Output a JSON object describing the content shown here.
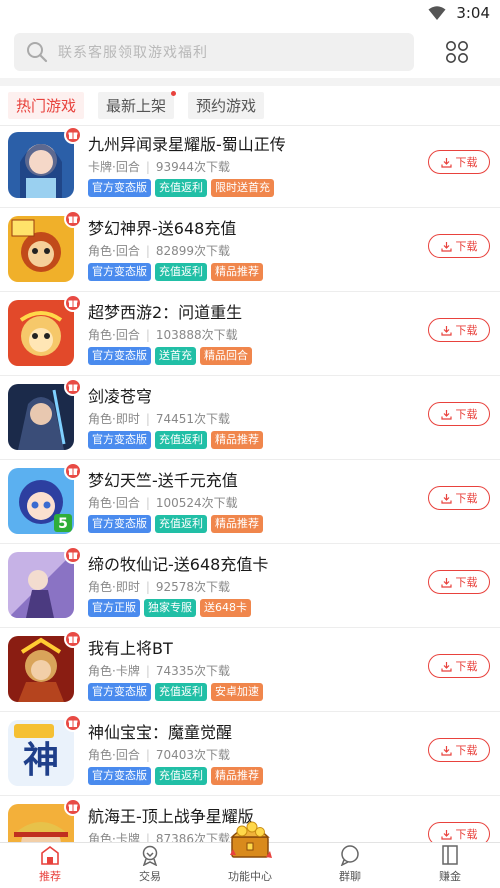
{
  "status_bar": {
    "time": "3:04"
  },
  "search": {
    "placeholder": "联系客服领取游戏福利"
  },
  "tabs": [
    {
      "label": "热门游戏",
      "active": true
    },
    {
      "label": "最新上架",
      "active": false,
      "dot": true
    },
    {
      "label": "预约游戏",
      "active": false
    }
  ],
  "games": [
    {
      "name": "九州异闻录星耀版-蜀山正传",
      "category": "卡牌·回合",
      "downloads": "93944次下载",
      "tags": [
        {
          "text": "官方变态版",
          "color": "blue"
        },
        {
          "text": "充值返利",
          "color": "teal"
        },
        {
          "text": "限时送首充",
          "color": "orange"
        }
      ],
      "download_label": "下载",
      "icon": "anime-girl-icon"
    },
    {
      "name": "梦幻神界-送648充值",
      "category": "角色·回合",
      "downloads": "82899次下载",
      "tags": [
        {
          "text": "官方变态版",
          "color": "blue"
        },
        {
          "text": "充值返利",
          "color": "teal"
        },
        {
          "text": "精品推荐",
          "color": "orange"
        }
      ],
      "download_label": "下载",
      "icon": "monkey-king-icon"
    },
    {
      "name": "超梦西游2：问道重生",
      "category": "角色·回合",
      "downloads": "103888次下载",
      "tags": [
        {
          "text": "官方变态版",
          "color": "blue"
        },
        {
          "text": "送首充",
          "color": "teal"
        },
        {
          "text": "精品回合",
          "color": "orange"
        }
      ],
      "download_label": "下载",
      "icon": "golden-monkey-icon"
    },
    {
      "name": "剑凌苍穹",
      "category": "角色·即时",
      "downloads": "74451次下载",
      "tags": [
        {
          "text": "官方变态版",
          "color": "blue"
        },
        {
          "text": "充值返利",
          "color": "teal"
        },
        {
          "text": "精品推荐",
          "color": "orange"
        }
      ],
      "download_label": "下载",
      "icon": "swordsman-icon"
    },
    {
      "name": "梦幻天竺-送千元充值",
      "category": "角色·回合",
      "downloads": "100524次下载",
      "tags": [
        {
          "text": "官方变态版",
          "color": "blue"
        },
        {
          "text": "充值返利",
          "color": "teal"
        },
        {
          "text": "精品推荐",
          "color": "orange"
        }
      ],
      "download_label": "下载",
      "icon": "blue-hair-girl-icon",
      "badge": "5"
    },
    {
      "name": "缔の牧仙记-送648充值卡",
      "category": "角色·即时",
      "downloads": "92578次下载",
      "tags": [
        {
          "text": "官方正版",
          "color": "blue"
        },
        {
          "text": "独家专服",
          "color": "teal"
        },
        {
          "text": "送648卡",
          "color": "orange"
        }
      ],
      "download_label": "下载",
      "icon": "fairy-warrior-icon"
    },
    {
      "name": "我有上将BT",
      "category": "角色·卡牌",
      "downloads": "74335次下载",
      "tags": [
        {
          "text": "官方变态版",
          "color": "blue"
        },
        {
          "text": "充值返利",
          "color": "teal"
        },
        {
          "text": "安卓加速",
          "color": "orange"
        }
      ],
      "download_label": "下载",
      "icon": "general-icon"
    },
    {
      "name": "神仙宝宝：魔童觉醒",
      "category": "角色·回合",
      "downloads": "70403次下载",
      "tags": [
        {
          "text": "官方变态版",
          "color": "blue"
        },
        {
          "text": "充值返利",
          "color": "teal"
        },
        {
          "text": "精品推荐",
          "color": "orange"
        }
      ],
      "download_label": "下载",
      "icon": "shen-character-icon",
      "icon_text": "神"
    },
    {
      "name": "航海王-顶上战争星耀版",
      "category": "角色·卡牌",
      "downloads": "87386次下载",
      "tags": [],
      "download_label": "下载",
      "icon": "pirate-icon"
    }
  ],
  "bottom_nav": [
    {
      "label": "推荐",
      "active": true,
      "icon": "home-icon"
    },
    {
      "label": "交易",
      "active": false,
      "icon": "trade-icon"
    },
    {
      "label": "功能中心",
      "active": false,
      "icon": "treasure-chest-icon"
    },
    {
      "label": "群聊",
      "active": false,
      "icon": "chat-icon"
    },
    {
      "label": "赚金",
      "active": false,
      "icon": "book-icon"
    }
  ],
  "colors": {
    "accent": "#e8423d",
    "tag_blue": "#4a8bee",
    "tag_teal": "#21bfa6",
    "tag_orange": "#f0864c"
  }
}
